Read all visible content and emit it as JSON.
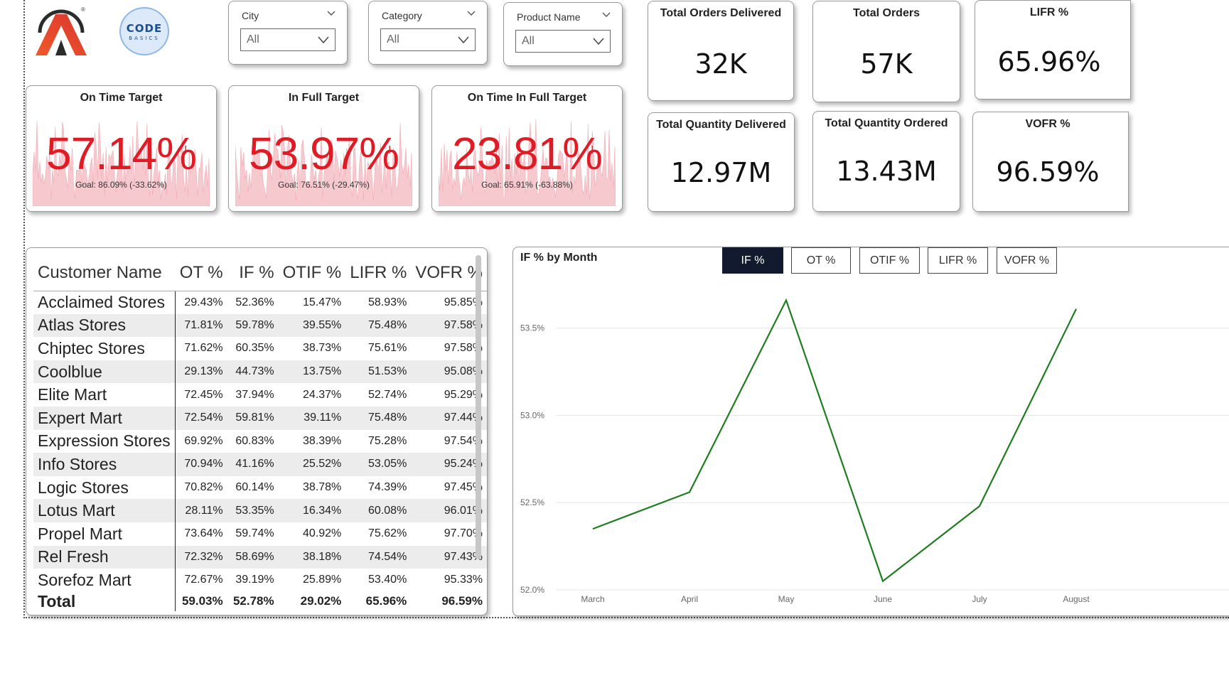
{
  "logos": {
    "code_basics_line1": "ODE",
    "code_basics_line2": "BASICS",
    "atliq_mark": "®"
  },
  "filters": [
    {
      "label": "City",
      "value": "All"
    },
    {
      "label": "Category",
      "value": "All"
    },
    {
      "label": "Product Name",
      "value": "All"
    }
  ],
  "targets": [
    {
      "title": "On Time Target",
      "value": "57.14%",
      "goal": "Goal: 86.09% (-33.62%)",
      "flag": "!"
    },
    {
      "title": "In Full Target",
      "value": "53.97%",
      "goal": "Goal: 76.51% (-29.47%)",
      "flag": "!"
    },
    {
      "title": "On Time In Full Target",
      "value": "23.81%",
      "goal": "Goal: 65.91% (-63.88%)",
      "flag": "!"
    }
  ],
  "kpis": [
    {
      "title": "Total Orders Delivered",
      "value": "32K"
    },
    {
      "title": "Total Orders",
      "value": "57K"
    },
    {
      "title": "LIFR %",
      "value": "65.96%"
    },
    {
      "title": "Total Quantity Delivered",
      "value": "12.97M"
    },
    {
      "title": "Total Quantity Ordered",
      "value": "13.43M"
    },
    {
      "title": "VOFR %",
      "value": "96.59%"
    }
  ],
  "table": {
    "headers": [
      "Customer Name",
      "OT %",
      "IF %",
      "OTIF %",
      "LIFR %",
      "VOFR %"
    ],
    "rows": [
      [
        "Acclaimed Stores",
        "29.43%",
        "52.36%",
        "15.47%",
        "58.93%",
        "95.85%"
      ],
      [
        "Atlas Stores",
        "71.81%",
        "59.78%",
        "39.55%",
        "75.48%",
        "97.58%"
      ],
      [
        "Chiptec Stores",
        "71.62%",
        "60.35%",
        "38.73%",
        "75.61%",
        "97.58%"
      ],
      [
        "Coolblue",
        "29.13%",
        "44.73%",
        "13.75%",
        "51.53%",
        "95.08%"
      ],
      [
        "Elite Mart",
        "72.45%",
        "37.94%",
        "24.37%",
        "52.74%",
        "95.29%"
      ],
      [
        "Expert Mart",
        "72.54%",
        "59.81%",
        "39.11%",
        "75.48%",
        "97.44%"
      ],
      [
        "Expression Stores",
        "69.92%",
        "60.83%",
        "38.39%",
        "75.28%",
        "97.54%"
      ],
      [
        "Info Stores",
        "70.94%",
        "41.16%",
        "25.52%",
        "53.05%",
        "95.24%"
      ],
      [
        "Logic Stores",
        "70.82%",
        "60.14%",
        "38.78%",
        "74.39%",
        "97.45%"
      ],
      [
        "Lotus Mart",
        "28.11%",
        "53.35%",
        "16.34%",
        "60.08%",
        "96.01%"
      ],
      [
        "Propel Mart",
        "73.64%",
        "59.74%",
        "40.92%",
        "75.62%",
        "97.70%"
      ],
      [
        "Rel Fresh",
        "72.32%",
        "58.69%",
        "38.18%",
        "74.54%",
        "97.43%"
      ],
      [
        "Sorefoz Mart",
        "72.67%",
        "39.19%",
        "25.89%",
        "53.40%",
        "95.33%"
      ]
    ],
    "total": [
      "Total",
      "59.03%",
      "52.78%",
      "29.02%",
      "65.96%",
      "96.59%"
    ]
  },
  "chart": {
    "title": "IF % by Month",
    "buttons": [
      "IF %",
      "OT %",
      "OTIF %",
      "LIFR %",
      "VOFR %"
    ],
    "active_button": "IF %"
  },
  "chart_data": {
    "type": "line",
    "title": "IF % by Month",
    "categories": [
      "March",
      "April",
      "May",
      "June",
      "July",
      "August"
    ],
    "series": [
      {
        "values": [
          52.35,
          52.56,
          53.66,
          52.05,
          52.48,
          53.61
        ],
        "color": "#1e7d1e"
      }
    ],
    "y_ticks": [
      "52.0%",
      "52.5%",
      "53.0%",
      "53.5%"
    ],
    "y_tick_values": [
      52.0,
      52.5,
      53.0,
      53.5
    ],
    "ylim": [
      52.0,
      53.8
    ],
    "grid": true
  },
  "colors": {
    "accent_red": "#e01b24",
    "line_green": "#1e7d1e",
    "active_btn": "#111a2e",
    "spark_pink": "#f6c9cf"
  }
}
